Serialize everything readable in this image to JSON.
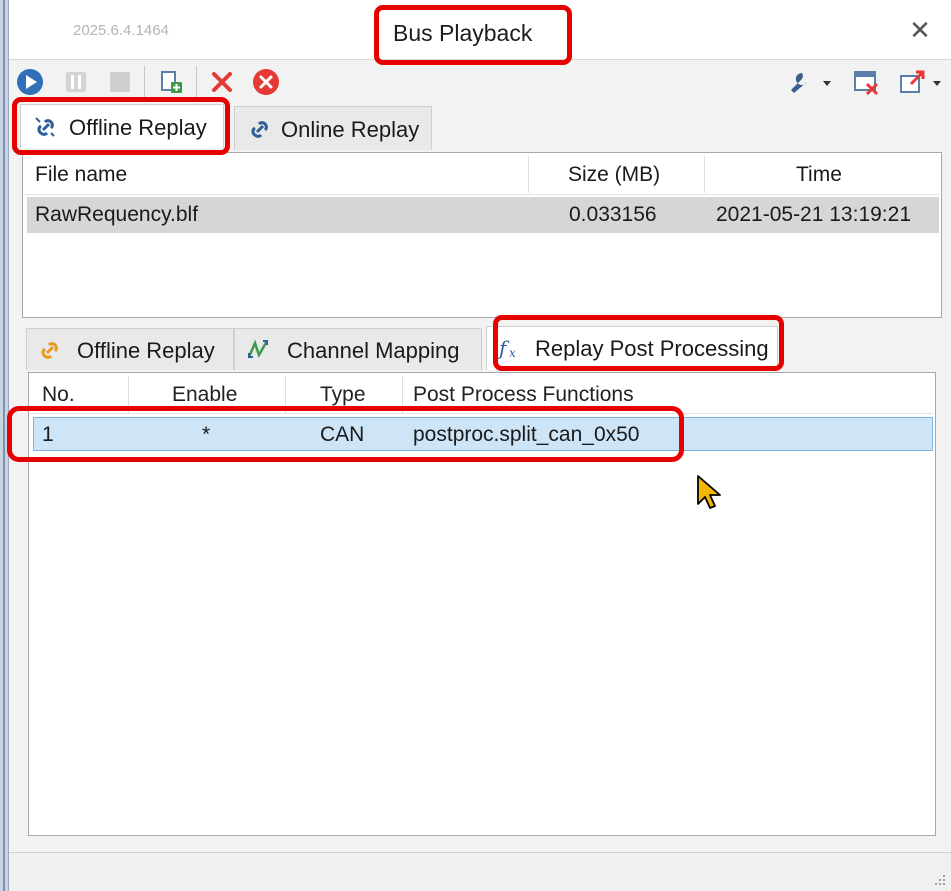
{
  "window": {
    "version": "2025.6.4.1464",
    "title": "Bus Playback",
    "close_glyph": "✕"
  },
  "toolbar": {
    "icons": [
      "play-icon",
      "pause-icon",
      "stop-icon",
      "add-file-icon",
      "delete-icon",
      "clear-all-icon",
      "settings-wrench-icon",
      "close-window-icon",
      "export-icon"
    ],
    "colors": {
      "play": "#2f6fb8",
      "delete": "#e53935",
      "clear": "#e53935",
      "disabled": "#c8c8c8"
    }
  },
  "top_tabs": [
    {
      "label": "Offline Replay",
      "icon": "offline-link-icon",
      "active": true
    },
    {
      "label": "Online Replay",
      "icon": "online-link-icon",
      "active": false
    }
  ],
  "files_table": {
    "columns": [
      "File name",
      "Size (MB)",
      "Time"
    ],
    "rows": [
      {
        "name": "RawRequency.blf",
        "size": "0.033156",
        "time": "2021-05-21 13:19:21"
      }
    ]
  },
  "bottom_tabs": [
    {
      "label": "Offline Replay",
      "icon": "orange-link-icon",
      "active": false
    },
    {
      "label": "Channel Mapping",
      "icon": "channel-mapping-icon",
      "active": false
    },
    {
      "label": "Replay Post Processing",
      "icon": "fx-icon",
      "active": true
    }
  ],
  "post_processing_table": {
    "columns": [
      "No.",
      "Enable",
      "Type",
      "Post Process Functions"
    ],
    "rows": [
      {
        "no": "1",
        "enable": "*",
        "type": "CAN",
        "function": "postproc.split_can_0x50"
      }
    ]
  },
  "annotation_color": "#e60000"
}
